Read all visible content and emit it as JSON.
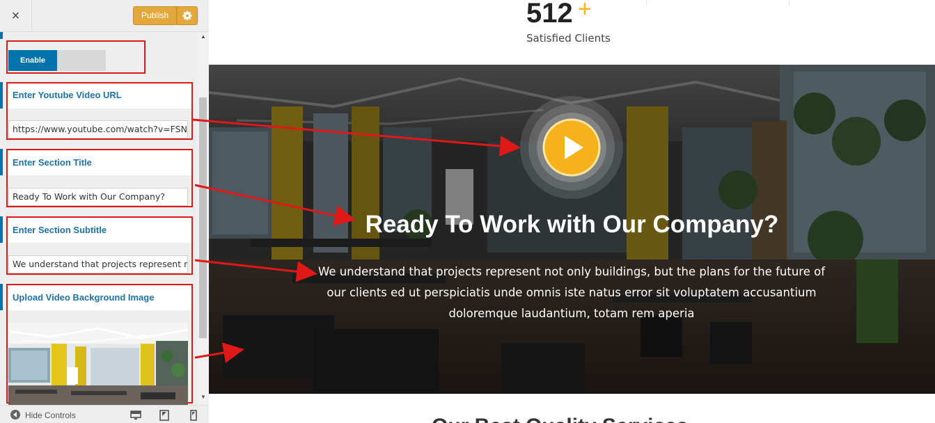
{
  "topbar": {
    "close_icon": "×",
    "publish_label": "Publish",
    "publish_color": "#e3a83a"
  },
  "controls": {
    "toggle_label": "Enable",
    "youtube": {
      "title": "Enter Youtube Video URL",
      "value": "https://www.youtube.com/watch?v=FSN"
    },
    "section_title": {
      "title": "Enter Section Title",
      "value": "Ready To Work with Our Company?"
    },
    "section_subtitle": {
      "title": "Enter Section Subtitle",
      "value": "We understand that projects represent n"
    },
    "bg_image": {
      "title": "Upload Video Background Image"
    },
    "accent_color": "#0073aa",
    "highlight_color": "#e01818"
  },
  "bottombar": {
    "hide_label": "Hide Controls"
  },
  "preview": {
    "stat_number": "512",
    "stat_plus": "+",
    "stat_label": "Satisfied Clients",
    "hero_title": "Ready To Work with Our Company?",
    "hero_subtitle": "We understand that projects represent not only buildings, but the plans for the future of our clients ed ut perspiciatis unde omnis iste natus error sit voluptatem accusantium doloremque laudantium, totam rem aperia",
    "next_section_title": "Our Best Quality Services",
    "play_color": "#f5b21d"
  }
}
